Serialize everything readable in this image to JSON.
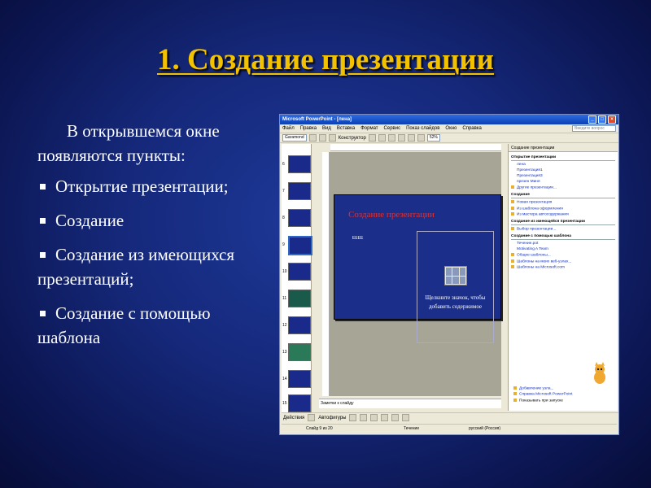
{
  "slide": {
    "title": "1. Создание презентации",
    "intro": "В открывшемся окне появляются пункты:",
    "bullets": [
      "Открытие презентации;",
      "Создание",
      "Создание из имеющихся презентаций;",
      "Создание с помощью шаблона"
    ]
  },
  "window": {
    "title": "Microsoft PowerPoint - [лена]",
    "menu": [
      "Файл",
      "Правка",
      "Вид",
      "Вставка",
      "Формат",
      "Сервис",
      "Показ слайдов",
      "Окно",
      "Справка"
    ],
    "help_placeholder": "Введите вопрос",
    "font_name": "Garamond",
    "toolbar_label": "Конструктор",
    "zoom": "52%",
    "thumb_numbers": [
      "6",
      "7",
      "8",
      "9",
      "10",
      "11",
      "12",
      "13",
      "14",
      "15"
    ],
    "slide_title": "Создание презентации",
    "slide_sub": "ЕЕЕЕ",
    "placeholder_text": "Щелкните значок, чтобы добавить содержимое",
    "notes": "Заметки к слайду",
    "draw_actions": "Действия",
    "draw_autoshapes": "Автофигуры",
    "status": {
      "slide": "Слайд 9 из 20",
      "design": "Течение",
      "lang": "русский (Россия)"
    },
    "taskpane": {
      "header": "Создание презентации",
      "sections": [
        {
          "title": "Открытие презентации",
          "links": [
            "лена",
            "Презентация1",
            "Презентация3",
            "презен Миня",
            "Другие презентации..."
          ]
        },
        {
          "title": "Создание",
          "links": [
            "Новая презентация",
            "Из шаблона оформления",
            "Из мастера автосодержания"
          ]
        },
        {
          "title": "Создание из имеющейся презентации",
          "links": [
            "Выбор презентации..."
          ]
        },
        {
          "title": "Создание с помощью шаблона",
          "links": [
            "Течение.pot",
            "Motivating A Team",
            "Общие шаблоны...",
            "Шаблоны на моих веб-узлах...",
            "Шаблоны на Microsoft.com"
          ]
        }
      ],
      "bottom_links": [
        "Добавление узла...",
        "Справка Microsoft PowerPoint",
        "Показывать при запуске"
      ]
    }
  }
}
